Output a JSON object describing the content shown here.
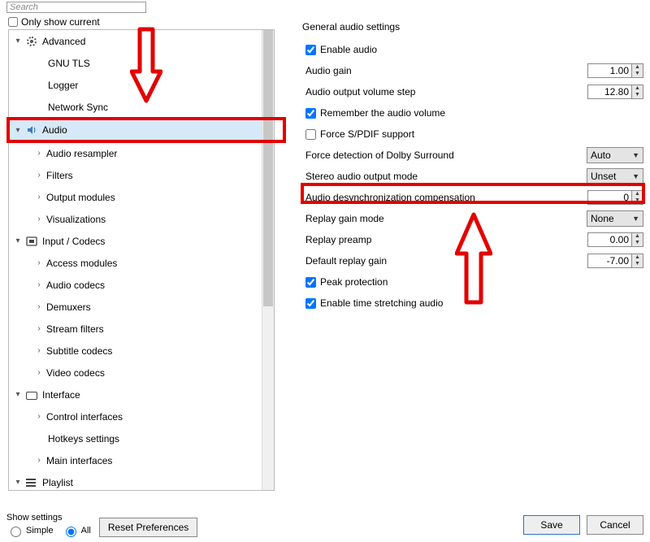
{
  "search": {
    "placeholder": "Search"
  },
  "only_show_current": "Only show current",
  "tree": {
    "advanced": "Advanced",
    "gnu_tls": "GNU TLS",
    "logger": "Logger",
    "network_sync": "Network Sync",
    "audio": "Audio",
    "audio_resampler": "Audio resampler",
    "filters": "Filters",
    "output_modules": "Output modules",
    "visualizations": "Visualizations",
    "input_codecs": "Input / Codecs",
    "access_modules": "Access modules",
    "audio_codecs": "Audio codecs",
    "demuxers": "Demuxers",
    "stream_filters": "Stream filters",
    "subtitle_codecs": "Subtitle codecs",
    "video_codecs": "Video codecs",
    "interface": "Interface",
    "control_interfaces": "Control interfaces",
    "hotkeys_settings": "Hotkeys settings",
    "main_interfaces": "Main interfaces",
    "playlist": "Playlist"
  },
  "section_title": "General audio settings",
  "settings": {
    "enable_audio": "Enable audio",
    "audio_gain": "Audio gain",
    "audio_gain_val": "1.00",
    "volume_step": "Audio output volume step",
    "volume_step_val": "12.80",
    "remember_volume": "Remember the audio volume",
    "force_spdif": "Force S/PDIF support",
    "dolby": "Force detection of Dolby Surround",
    "dolby_val": "Auto",
    "stereo_mode": "Stereo audio output mode",
    "stereo_mode_val": "Unset",
    "desync": "Audio desynchronization compensation",
    "desync_val": "0",
    "replay_mode": "Replay gain mode",
    "replay_mode_val": "None",
    "replay_preamp": "Replay preamp",
    "replay_preamp_val": "0.00",
    "default_replay": "Default replay gain",
    "default_replay_val": "-7.00",
    "peak_protection": "Peak protection",
    "time_stretch": "Enable time stretching audio"
  },
  "footer": {
    "show_settings": "Show settings",
    "simple": "Simple",
    "all": "All",
    "reset": "Reset Preferences",
    "save": "Save",
    "cancel": "Cancel"
  }
}
